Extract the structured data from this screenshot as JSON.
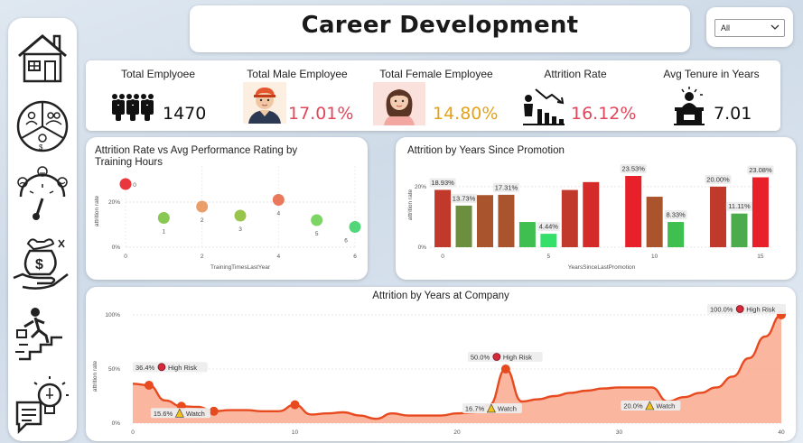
{
  "header": {
    "title": "Career Development"
  },
  "slicer": {
    "value": "All"
  },
  "kpis": [
    {
      "label": "Total Emplyoee",
      "value": "1470",
      "icon": "people-group-icon",
      "color": "#111111"
    },
    {
      "label": "Total Male Employee",
      "value": "17.01%",
      "icon": "male-avatar-icon",
      "color": "#e0475b"
    },
    {
      "label": "Total Female Employee",
      "value": "14.80%",
      "icon": "female-avatar-icon",
      "color": "#e3a21a"
    },
    {
      "label": "Attrition Rate",
      "value": "16.12%",
      "icon": "declining-chart-icon",
      "color": "#e0475b"
    },
    {
      "label": "Avg Tenure in Years",
      "value": "7.01",
      "icon": "desk-worker-icon",
      "color": "#111111"
    }
  ],
  "sidebar": {
    "icons": [
      "home-icon",
      "pie-demographics-icon",
      "satisfaction-gauge-icon",
      "salary-hand-icon",
      "career-stairs-icon",
      "ideas-chat-icon"
    ]
  },
  "colors": {
    "red": "#e8202a",
    "darkred": "#c0392b",
    "brown": "#a9542c",
    "olive": "#6b8e3f",
    "green": "#4cbb4c",
    "lightgreen": "#34e06a",
    "orange": "#e87a4a",
    "area": "#f9a98e",
    "areaLine": "#e84a1f"
  },
  "chart_data": [
    {
      "type": "scatter",
      "title": "Attrition Rate vs Avg Performance Rating by Training Hours",
      "xlabel": "TrainingTimesLastYear",
      "ylabel": "attrition rate",
      "xlim": [
        0,
        6
      ],
      "ylim": [
        0,
        0.32
      ],
      "xticks": [
        "0",
        "2",
        "4",
        "6"
      ],
      "yticks": [
        "0%",
        "20%"
      ],
      "points": [
        {
          "x": 0,
          "y": 0.28,
          "label": "0",
          "color": "#e8202a"
        },
        {
          "x": 1,
          "y": 0.13,
          "label": "1",
          "color": "#7cc242"
        },
        {
          "x": 2,
          "y": 0.18,
          "label": "2",
          "color": "#e8955a"
        },
        {
          "x": 3,
          "y": 0.14,
          "label": "3",
          "color": "#8fbf3a"
        },
        {
          "x": 4,
          "y": 0.21,
          "label": "4",
          "color": "#e86a4a"
        },
        {
          "x": 5,
          "y": 0.12,
          "label": "5",
          "color": "#6fd054"
        },
        {
          "x": 6,
          "y": 0.09,
          "label": "6",
          "color": "#3ed16a"
        }
      ]
    },
    {
      "type": "bar",
      "title": "Attrition by Years Since Promotion",
      "xlabel": "YearsSinceLastPromotion",
      "ylabel": "attrition rate",
      "ylim": [
        0,
        0.28
      ],
      "xticks": [
        "0",
        "5",
        "10",
        "15"
      ],
      "yticks": [
        "0%",
        "20%"
      ],
      "bars": [
        {
          "x": 0,
          "value": 0.1893,
          "label": "18.93%",
          "color": "#c0392b"
        },
        {
          "x": 1,
          "value": 0.1373,
          "label": "13.73%",
          "color": "#6b8e3f"
        },
        {
          "x": 2,
          "value": 0.172,
          "label": "",
          "color": "#a9542c"
        },
        {
          "x": 3,
          "value": 0.1731,
          "label": "17.31%",
          "color": "#a9542c"
        },
        {
          "x": 4,
          "value": 0.0833,
          "label": "",
          "color": "#3fbf4f"
        },
        {
          "x": 5,
          "value": 0.0444,
          "label": "4.44%",
          "color": "#34e06a"
        },
        {
          "x": 6,
          "value": 0.189,
          "label": "",
          "color": "#c0392b"
        },
        {
          "x": 7,
          "value": 0.215,
          "label": "",
          "color": "#d42a2a"
        },
        {
          "x": 9,
          "value": 0.2353,
          "label": "23.53%",
          "color": "#e8202a"
        },
        {
          "x": 10,
          "value": 0.1667,
          "label": "",
          "color": "#a9542c"
        },
        {
          "x": 11,
          "value": 0.0833,
          "label": "8.33%",
          "color": "#3fbf4f"
        },
        {
          "x": 13,
          "value": 0.2,
          "label": "20.00%",
          "color": "#c0392b"
        },
        {
          "x": 14,
          "value": 0.1111,
          "label": "11.11%",
          "color": "#4cab4c"
        },
        {
          "x": 15,
          "value": 0.2308,
          "label": "23.08%",
          "color": "#e8202a"
        }
      ]
    },
    {
      "type": "area",
      "title": "Attrition by Years at Company",
      "ylabel": "attrition rate",
      "xlim": [
        0,
        40
      ],
      "ylim": [
        0,
        1.0
      ],
      "xticks": [
        "0",
        "10",
        "20",
        "30",
        "40"
      ],
      "yticks": [
        "0%",
        "50%",
        "100%"
      ],
      "x": [
        0,
        1,
        2,
        3,
        4,
        5,
        6,
        7,
        8,
        9,
        10,
        11,
        12,
        13,
        14,
        15,
        16,
        17,
        18,
        19,
        20,
        21,
        22,
        23,
        24,
        25,
        26,
        27,
        28,
        29,
        30,
        31,
        32,
        33,
        34,
        35,
        36,
        37,
        38,
        39,
        40
      ],
      "y": [
        0.364,
        0.35,
        0.21,
        0.156,
        0.15,
        0.11,
        0.12,
        0.12,
        0.11,
        0.11,
        0.17,
        0.08,
        0.09,
        0.1,
        0.07,
        0.04,
        0.09,
        0.07,
        0.07,
        0.07,
        0.09,
        0.1,
        0.167,
        0.5,
        0.2,
        0.22,
        0.25,
        0.28,
        0.3,
        0.32,
        0.33,
        0.33,
        0.33,
        0.2,
        0.24,
        0.28,
        0.33,
        0.43,
        0.6,
        0.8,
        1.0
      ],
      "markers": [
        1,
        3,
        5,
        10,
        23,
        40
      ],
      "annotations": [
        {
          "x": 1,
          "y": 0.364,
          "text": "36.4%",
          "flag": "High Risk",
          "kind": "risk"
        },
        {
          "x": 3,
          "y": 0.156,
          "text": "15.6%",
          "flag": "Watch",
          "kind": "watch"
        },
        {
          "x": 23,
          "y": 0.5,
          "text": "50.0%",
          "flag": "High Risk",
          "kind": "risk"
        },
        {
          "x": 22,
          "y": 0.167,
          "text": "16.7%",
          "flag": "Watch",
          "kind": "watch"
        },
        {
          "x": 33,
          "y": 0.2,
          "text": "20.0%",
          "flag": "Watch",
          "kind": "watch"
        },
        {
          "x": 40,
          "y": 1.0,
          "text": "100.0%",
          "flag": "High Risk",
          "kind": "risk"
        }
      ]
    }
  ]
}
